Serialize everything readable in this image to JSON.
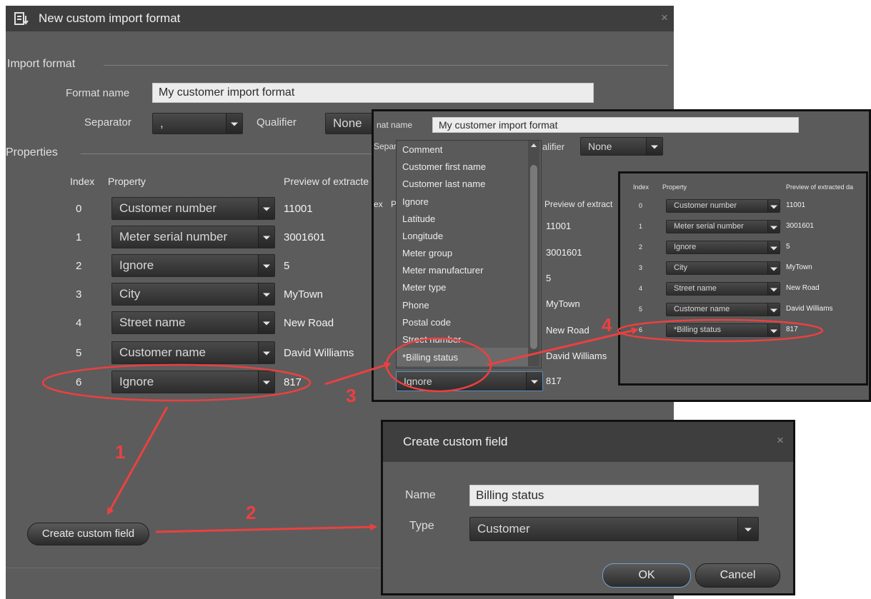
{
  "main": {
    "title": "New custom import format",
    "close_glyph": "×",
    "section_import": "Import format",
    "format_name_label": "Format name",
    "format_name_value": "My customer import format",
    "separator_label": "Separator",
    "separator_value": ",",
    "qualifier_label": "Qualifier",
    "qualifier_value": "None",
    "section_properties": "Properties",
    "col_index": "Index",
    "col_property": "Property",
    "col_preview": "Preview of extracte",
    "rows": [
      {
        "index": "0",
        "property": "Customer number",
        "preview": "11001"
      },
      {
        "index": "1",
        "property": "Meter serial number",
        "preview": "3001601"
      },
      {
        "index": "2",
        "property": "Ignore",
        "preview": "5"
      },
      {
        "index": "3",
        "property": "City",
        "preview": "MyTown"
      },
      {
        "index": "4",
        "property": "Street name",
        "preview": "New Road"
      },
      {
        "index": "5",
        "property": "Customer name",
        "preview": "David Williams"
      },
      {
        "index": "6",
        "property": "Ignore",
        "preview": "817"
      }
    ],
    "create_button": "Create custom field"
  },
  "zoom1": {
    "format_label": "nat name",
    "format_value": "My customer import format",
    "separator_label": "Separ",
    "qualifier_label": "alifier",
    "qualifier_value": "None",
    "col_index": "ex",
    "col_property": "P",
    "col_preview": "Preview of extract",
    "previews": [
      "11001",
      "3001601",
      "5",
      "MyTown",
      "New Road",
      "David Williams",
      "817"
    ],
    "list_items": [
      "Comment",
      "Customer first name",
      "Customer last name",
      "Ignore",
      "Latitude",
      "Longitude",
      "Meter group",
      "Meter manufacturer",
      "Meter type",
      "Phone",
      "Postal code",
      "Street number",
      "*Billing status"
    ],
    "dropdown_value": "Ignore"
  },
  "zoom2": {
    "col_index": "Index",
    "col_property": "Property",
    "col_preview": "Preview of extracted da",
    "rows": [
      {
        "index": "0",
        "property": "Customer number",
        "preview": "11001"
      },
      {
        "index": "1",
        "property": "Meter serial number",
        "preview": "3001601"
      },
      {
        "index": "2",
        "property": "Ignore",
        "preview": "5"
      },
      {
        "index": "3",
        "property": "City",
        "preview": "MyTown"
      },
      {
        "index": "4",
        "property": "Street name",
        "preview": "New Road"
      },
      {
        "index": "5",
        "property": "Customer name",
        "preview": "David Williams"
      },
      {
        "index": "6",
        "property": "*Billing status",
        "preview": "817"
      }
    ]
  },
  "dialog": {
    "title": "Create custom field",
    "close_glyph": "×",
    "name_label": "Name",
    "name_value": "Billing status",
    "type_label": "Type",
    "type_value": "Customer",
    "ok": "OK",
    "cancel": "Cancel"
  },
  "annotations": {
    "step1": "1",
    "step2": "2",
    "step3": "3",
    "step4": "4"
  },
  "colors": {
    "annotation": "#ec4040",
    "dialog_bg": "#5c5c5c",
    "titlebar": "#3e3e3e"
  }
}
